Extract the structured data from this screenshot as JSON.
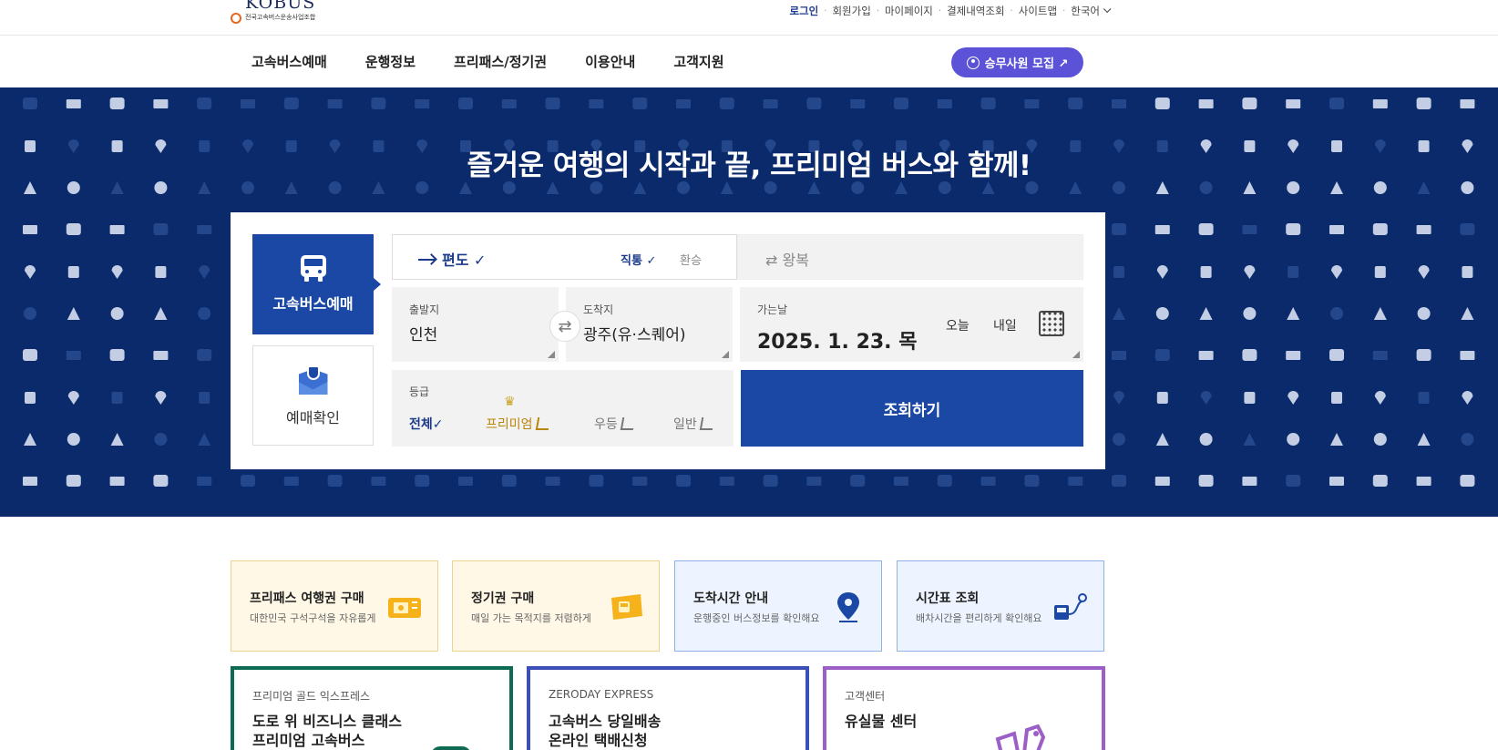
{
  "logo": {
    "word": "KOBUS",
    "sub": "전국고속버스운송사업조합"
  },
  "util": {
    "login": "로그인",
    "signup": "회원가입",
    "mypage": "마이페이지",
    "payments": "결제내역조회",
    "sitemap": "사이트맵",
    "language": "한국어"
  },
  "nav": {
    "items": [
      "고속버스예매",
      "운행정보",
      "프리패스/정기권",
      "이용안내",
      "고객지원"
    ],
    "recruit": "승무사원 모집 ↗"
  },
  "hero": {
    "title": "즐거운 여행의 시작과 끝, 프리미엄 버스와 함께!"
  },
  "tabs": {
    "booking": "고속버스예매",
    "confirm": "예매확인"
  },
  "trip": {
    "oneway": "편도 ✓",
    "direct": "직통 ✓",
    "transfer": "환승",
    "round": "⇄  왕복"
  },
  "dep": {
    "label": "출발지",
    "value": "인천"
  },
  "arr": {
    "label": "도착지",
    "value": "광주(유·스퀘어)"
  },
  "date": {
    "label": "가는날",
    "value": "2025. 1. 23. 목",
    "today": "오늘",
    "tomorrow": "내일"
  },
  "grade": {
    "label": "등급",
    "all": "전체✓",
    "premium": "프리미엄",
    "woodeung": "우등",
    "general": "일반"
  },
  "search": {
    "label": "조회하기"
  },
  "quick": [
    {
      "title": "프리패스 여행권 구매",
      "sub": "대한민국 구석구석을 자유롭게"
    },
    {
      "title": "정기권 구매",
      "sub": "매일 가는 목적지를 저렴하게"
    },
    {
      "title": "도착시간 안내",
      "sub": "운행중인 버스정보를 확인해요"
    },
    {
      "title": "시간표 조회",
      "sub": "배차시간을 편리하게 확인해요"
    }
  ],
  "promo": [
    {
      "tag": "프리미엄 골드 익스프레스",
      "line1": "도로 위 비즈니스 클래스",
      "line2": "프리미엄 고속버스"
    },
    {
      "tag": "ZERODAY EXPRESS",
      "line1": "고속버스 당일배송",
      "line2": "온라인 택배신청"
    },
    {
      "tag": "고객센터",
      "line1": "유실물 센터",
      "line2": ""
    }
  ],
  "colors": {
    "hero": "#0b2a6b",
    "primary": "#1b48a4",
    "recruit": "#5b52d8"
  }
}
